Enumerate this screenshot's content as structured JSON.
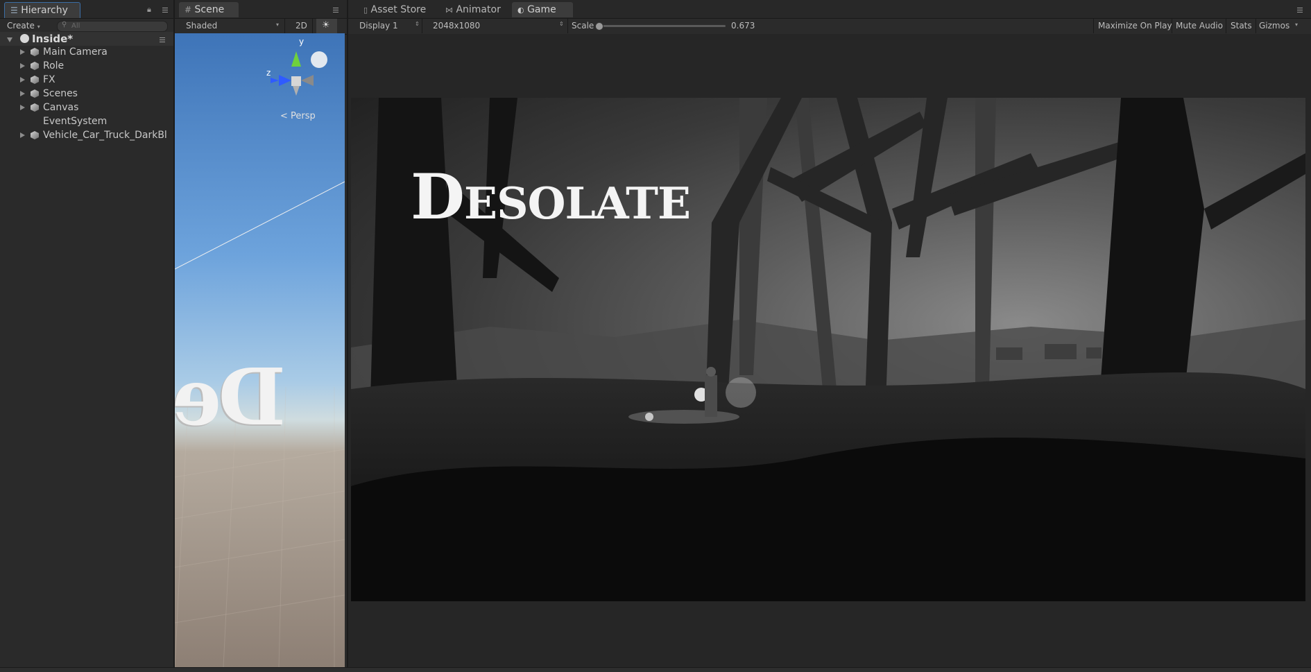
{
  "hierarchy": {
    "tab_label": "Hierarchy",
    "create_label": "Create",
    "search_placeholder": "All",
    "scene_name": "Inside*",
    "items": [
      {
        "label": "Main Camera",
        "expandable": true
      },
      {
        "label": "Role",
        "expandable": true
      },
      {
        "label": "FX",
        "expandable": true
      },
      {
        "label": "Scenes",
        "expandable": true
      },
      {
        "label": "Canvas",
        "expandable": true
      },
      {
        "label": "EventSystem",
        "expandable": false
      },
      {
        "label": "Vehicle_Car_Truck_DarkBl",
        "expandable": true
      }
    ]
  },
  "scene": {
    "tab_label": "Scene",
    "shading_mode": "Shaded",
    "mode_2d": "2D",
    "gizmo_y": "y",
    "gizmo_z": "z",
    "projection": "Persp",
    "preview_text": "Des"
  },
  "tabs": {
    "asset_store": "Asset Store",
    "animator": "Animator",
    "game": "Game"
  },
  "game": {
    "display": "Display 1",
    "resolution": "2048x1080",
    "scale_label": "Scale",
    "scale_value": "0.673",
    "scale_fraction": 0.0,
    "maximize": "Maximize On Play",
    "mute": "Mute Audio",
    "stats": "Stats",
    "gizmos": "Gizmos",
    "title": "Desolate"
  },
  "colors": {
    "accent_tab": "#3c3c3c",
    "gizmo_y": "#6fd13c",
    "gizmo_z": "#2f5bff",
    "background": "#1e1e1e"
  }
}
